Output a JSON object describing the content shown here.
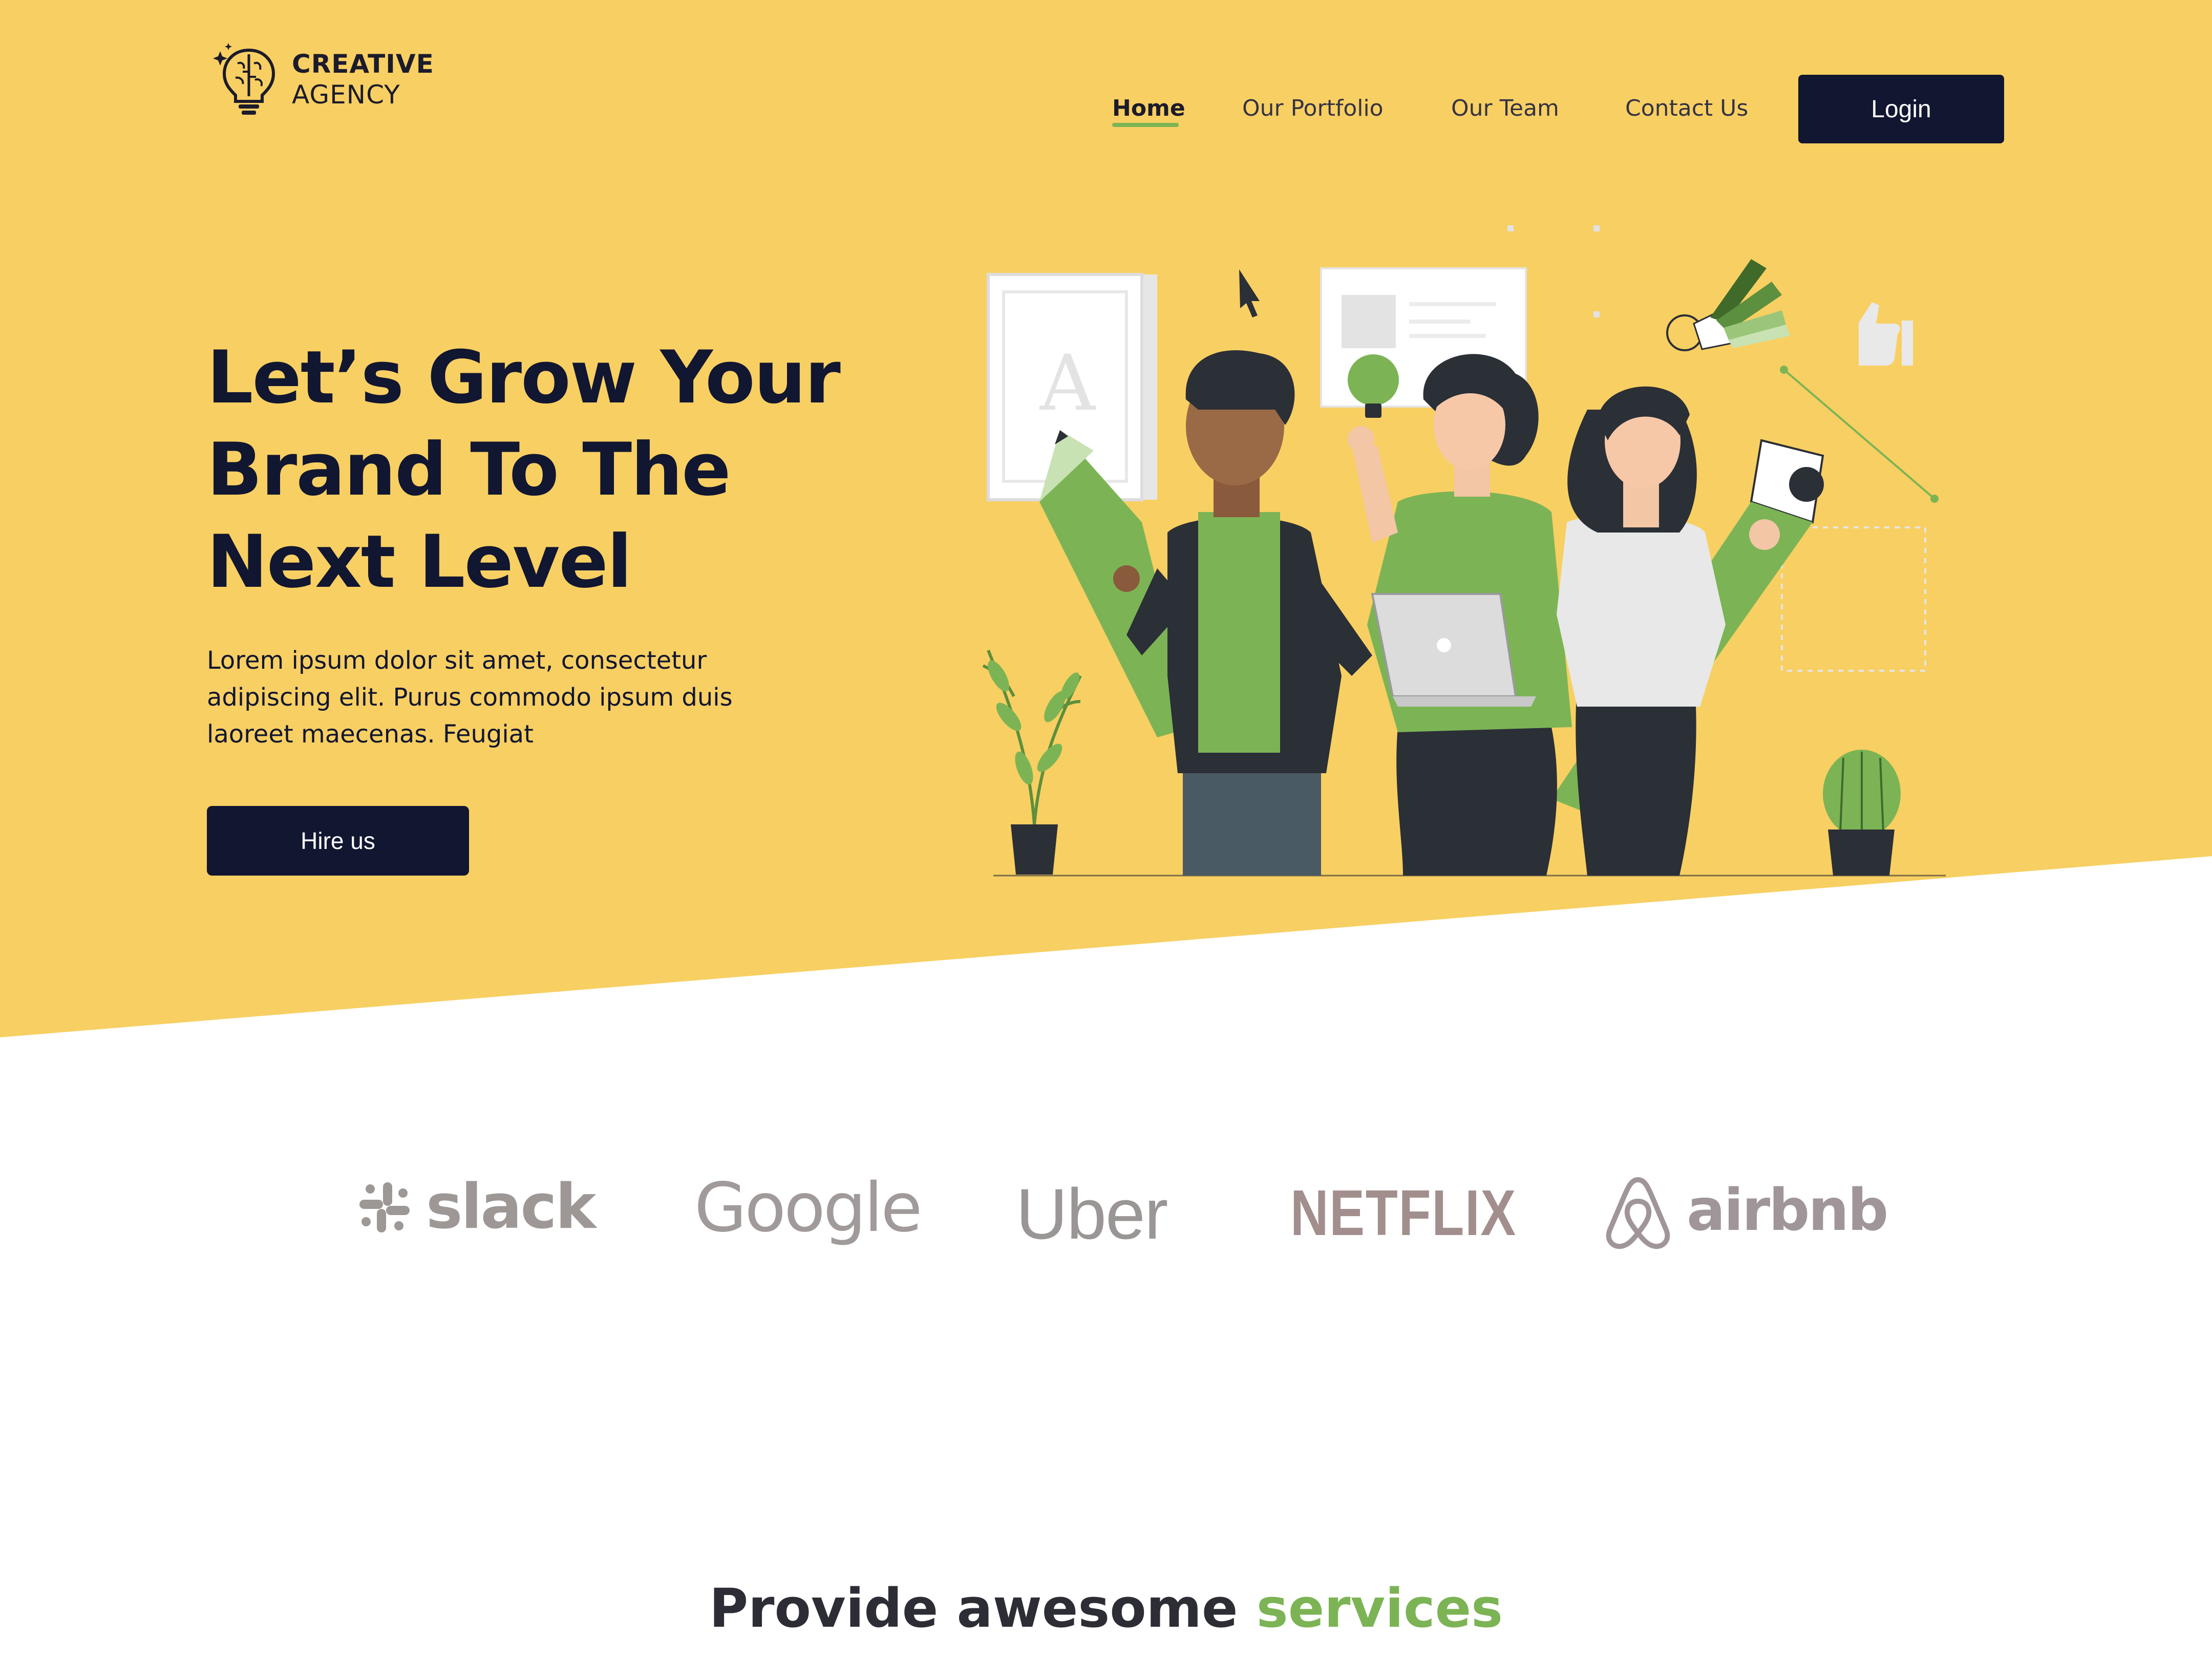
{
  "brand": {
    "line1": "CREATIVE",
    "line2": "AGENCY"
  },
  "nav": {
    "items": [
      {
        "label": "Home",
        "active": true
      },
      {
        "label": "Our Portfolio",
        "active": false
      },
      {
        "label": "Our Team",
        "active": false
      },
      {
        "label": "Contact Us",
        "active": false
      }
    ],
    "login_label": "Login"
  },
  "hero": {
    "headline": [
      "Let’s Grow Your",
      "Brand To The",
      "Next Level"
    ],
    "subtext": "Lorem ipsum dolor sit amet, consectetur adipiscing elit. Purus commodo ipsum duis laoreet maecenas. Feugiat",
    "cta_label": "Hire us",
    "illustration_letter": "A"
  },
  "partners": [
    "slack",
    "Google",
    "Uber",
    "NETFLIX",
    "airbnb"
  ],
  "services": {
    "title_main": "Provide awesome",
    "title_accent": "services"
  },
  "colors": {
    "hero_bg": "#f8cf62",
    "primary_dark": "#111631",
    "accent_green": "#7cb455",
    "logo_gray": "#9d9896"
  },
  "icons": [
    "brain-bulb-icon",
    "cursor-icon",
    "lightbulb-icon",
    "thumbs-up-icon",
    "slack-icon",
    "airbnb-icon"
  ]
}
